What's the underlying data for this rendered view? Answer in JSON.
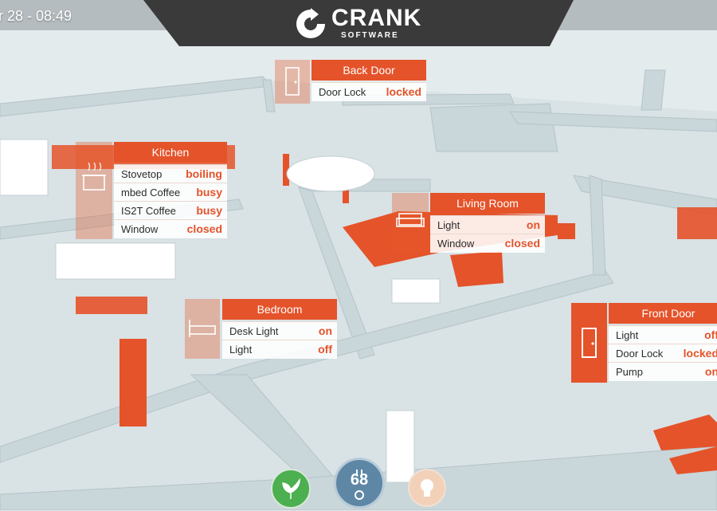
{
  "header": {
    "datetime": "r 28 - 08:49",
    "brand": "CRANK",
    "brand_sub": "SOFTWARE"
  },
  "colors": {
    "accent": "#e5532a",
    "header_bg": "#3a3a3a"
  },
  "rooms": {
    "back_door": {
      "title": "Back Door",
      "icon": "door-icon",
      "rows": [
        {
          "label": "Door Lock",
          "value": "locked"
        }
      ]
    },
    "kitchen": {
      "title": "Kitchen",
      "icon": "stove-icon",
      "rows": [
        {
          "label": "Stovetop",
          "value": "boiling"
        },
        {
          "label": "mbed Coffee",
          "value": "busy"
        },
        {
          "label": "IS2T Coffee",
          "value": "busy"
        },
        {
          "label": "Window",
          "value": "closed"
        }
      ]
    },
    "living_room": {
      "title": "Living Room",
      "icon": "sofa-icon",
      "rows": [
        {
          "label": "Light",
          "value": "on"
        },
        {
          "label": "Window",
          "value": "closed"
        }
      ]
    },
    "bedroom": {
      "title": "Bedroom",
      "icon": "bed-icon",
      "rows": [
        {
          "label": "Desk Light",
          "value": "on"
        },
        {
          "label": "Light",
          "value": "off"
        }
      ]
    },
    "front_door": {
      "title": "Front Door",
      "icon": "door-icon",
      "rows": [
        {
          "label": "Light",
          "value": "off"
        },
        {
          "label": "Door Lock",
          "value": "locked"
        },
        {
          "label": "Pump",
          "value": "on"
        }
      ]
    }
  },
  "bottom_bar": {
    "temperature": "68",
    "buttons": [
      "leaf-icon",
      "thermostat-icon",
      "bulb-icon"
    ]
  }
}
